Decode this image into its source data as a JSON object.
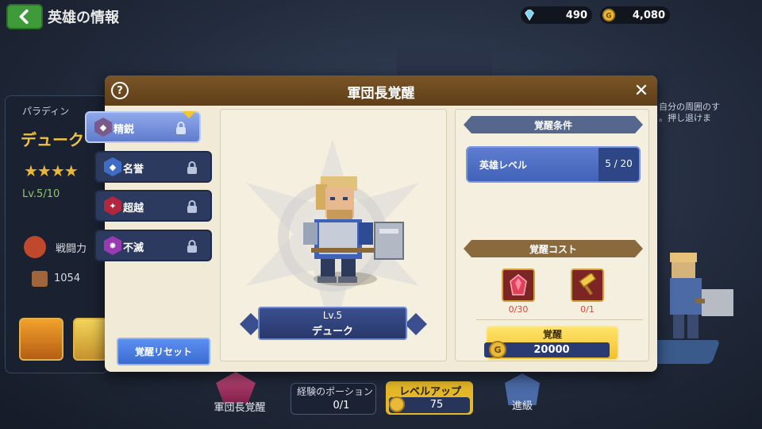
{
  "topbar": {
    "title": "英雄の情報",
    "gems": "490",
    "gold": "4,080"
  },
  "background": {
    "hero_class": "パラディン",
    "hero_name": "デューク",
    "stars": "★★★★",
    "level": "Lv.5/10",
    "power_label": "戦闘力",
    "attack": "1054",
    "right_hint": "自分の周囲のす\n。押し退けま",
    "bottom": {
      "awaken_label": "軍団長覚醒",
      "potion_label": "経験のポーション",
      "potion_value": "0/1",
      "levelup_label": "レベルアップ",
      "levelup_cost": "75",
      "promotion_label": "進級"
    }
  },
  "modal": {
    "title": "軍団長覚醒",
    "help_icon": "?",
    "close_icon": "✕",
    "tabs": [
      {
        "label": "精鋭",
        "selected": true,
        "color": "#7a5a8a"
      },
      {
        "label": "名誉",
        "selected": false,
        "color": "#3f6cc4"
      },
      {
        "label": "超越",
        "selected": false,
        "color": "#b3263f"
      },
      {
        "label": "不滅",
        "selected": false,
        "color": "#9a3ab0"
      }
    ],
    "reset_label": "覚醒リセット",
    "hero": {
      "level": "Lv.5",
      "name": "デューク"
    },
    "conditions": {
      "header": "覚醒条件",
      "label": "英雄レベル",
      "value": "5 / 20"
    },
    "cost": {
      "header": "覚醒コスト",
      "items": [
        {
          "icon": "red-crystal-icon",
          "count": "0/30"
        },
        {
          "icon": "golden-hammer-icon",
          "count": "0/1"
        }
      ],
      "button_label": "覚醒",
      "coin_symbol": "G",
      "gold_cost": "20000"
    }
  }
}
